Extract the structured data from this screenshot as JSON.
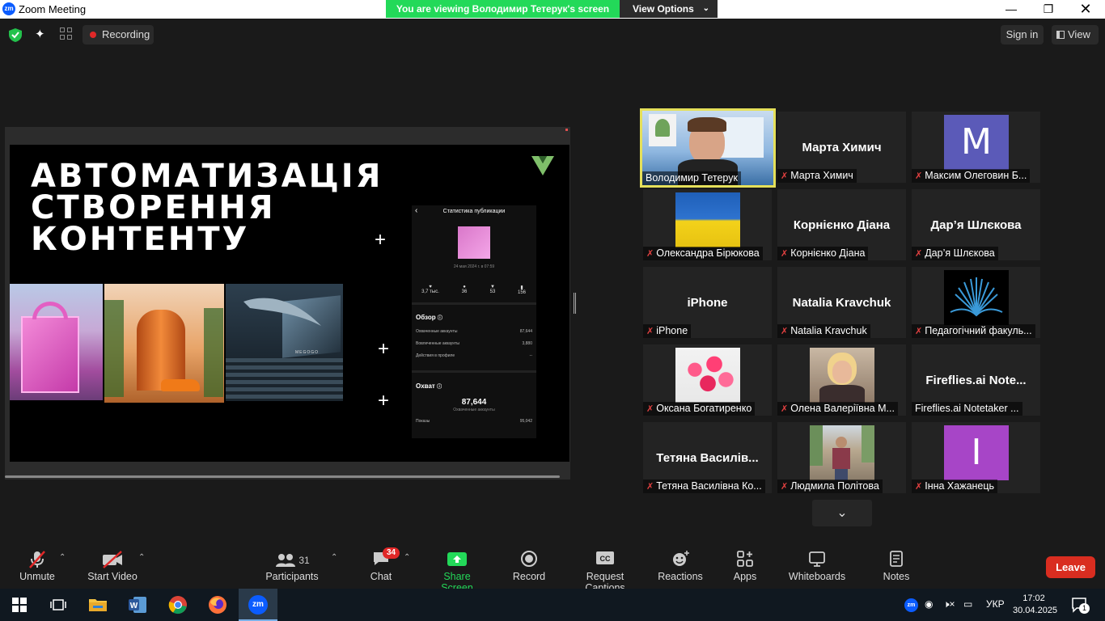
{
  "window": {
    "title": "Zoom Meeting",
    "logo": "zm",
    "controls": [
      "minimize-icon",
      "maximize-icon",
      "close-icon"
    ]
  },
  "banner": {
    "text": "You are viewing Володимир Тетерук's screen",
    "view_options": "View Options"
  },
  "topbar": {
    "recording": "Recording",
    "sign_in": "Sign in",
    "view": "View"
  },
  "slide": {
    "title_line1": "АВТОМАТИЗАЦІЯ",
    "title_line2": "СТВОРЕННЯ",
    "title_line3": "КОНТЕНТУ",
    "image_labels": [
      "MEGOGO"
    ],
    "phone": {
      "header": "Статистика публикации",
      "date": "24 мая 2024 г. в 07:59",
      "stats": [
        "3,7 тыс.",
        "36",
        "53",
        "156"
      ],
      "overview_title": "Обзор",
      "overview_rows": [
        {
          "label": "Охваченные аккаунты",
          "value": "87,644"
        },
        {
          "label": "Вовлеченные аккаунты",
          "value": "3,880"
        },
        {
          "label": "Действия в профиле",
          "value": "--"
        }
      ],
      "reach_title": "Охват",
      "reach_value": "87,644",
      "reach_sub": "Охваченные аккаунты",
      "impressions_label": "Показы",
      "impressions_value": "95,042"
    }
  },
  "participants": [
    {
      "name": "Володимир Тетерук",
      "type": "video",
      "active": true,
      "muted": false
    },
    {
      "name": "Марта Химич",
      "big": "Марта Химич",
      "type": "text",
      "muted": true
    },
    {
      "name": "Максим Олеговин Б...",
      "letter": "M",
      "color": "#5b5ab8",
      "type": "letter",
      "muted": true
    },
    {
      "name": "Олександра Бірюкова",
      "type": "flag",
      "muted": true
    },
    {
      "name": "Корнієнко Діана",
      "big": "Корнієнко Діана",
      "type": "text",
      "muted": true
    },
    {
      "name": "Дар’я Шлєкова",
      "big": "Дар’я Шлєкова",
      "type": "text",
      "muted": true
    },
    {
      "name": "iPhone",
      "big": "iPhone",
      "type": "text",
      "muted": true
    },
    {
      "name": "Natalia Kravchuk",
      "big": "Natalia Kravchuk",
      "type": "text",
      "muted": true
    },
    {
      "name": "Педагогічний факуль...",
      "type": "book",
      "muted": true
    },
    {
      "name": "Оксана Богатиренко",
      "type": "roses",
      "muted": true
    },
    {
      "name": "Олена Валеріївна М...",
      "type": "photo",
      "muted": true
    },
    {
      "name": "Fireflies.ai Notetaker ...",
      "big": "Fireflies.ai  Note...",
      "type": "text",
      "muted": false
    },
    {
      "name": "Тетяна Василівна Ко...",
      "big": "Тетяна  Василів...",
      "type": "text",
      "muted": true
    },
    {
      "name": "Людмила Політова",
      "type": "street",
      "muted": true
    },
    {
      "name": "Інна Хажанець",
      "letter": "I",
      "color": "#a745c7",
      "type": "letter",
      "muted": true
    }
  ],
  "toolbar": {
    "unmute": "Unmute",
    "start_video": "Start Video",
    "participants": "Participants",
    "participants_count": "31",
    "chat": "Chat",
    "chat_badge": "34",
    "share_screen": "Share Screen",
    "record": "Record",
    "captions": "Request Captions",
    "reactions": "Reactions",
    "apps": "Apps",
    "whiteboards": "Whiteboards",
    "notes": "Notes",
    "leave": "Leave"
  },
  "taskbar": {
    "lang": "УКР",
    "time": "17:02",
    "date": "30.04.2025",
    "notif_count": "1",
    "apps": [
      "windows-start-icon",
      "task-view-icon",
      "file-explorer-icon",
      "word-icon",
      "chrome-icon",
      "firefox-icon",
      "zoom-icon"
    ]
  },
  "colors": {
    "banner_green": "#23d959",
    "share_green": "#23d959",
    "leave_red": "#d92d20",
    "active_speaker": "#e5e05a",
    "record_dot": "#e02828"
  }
}
